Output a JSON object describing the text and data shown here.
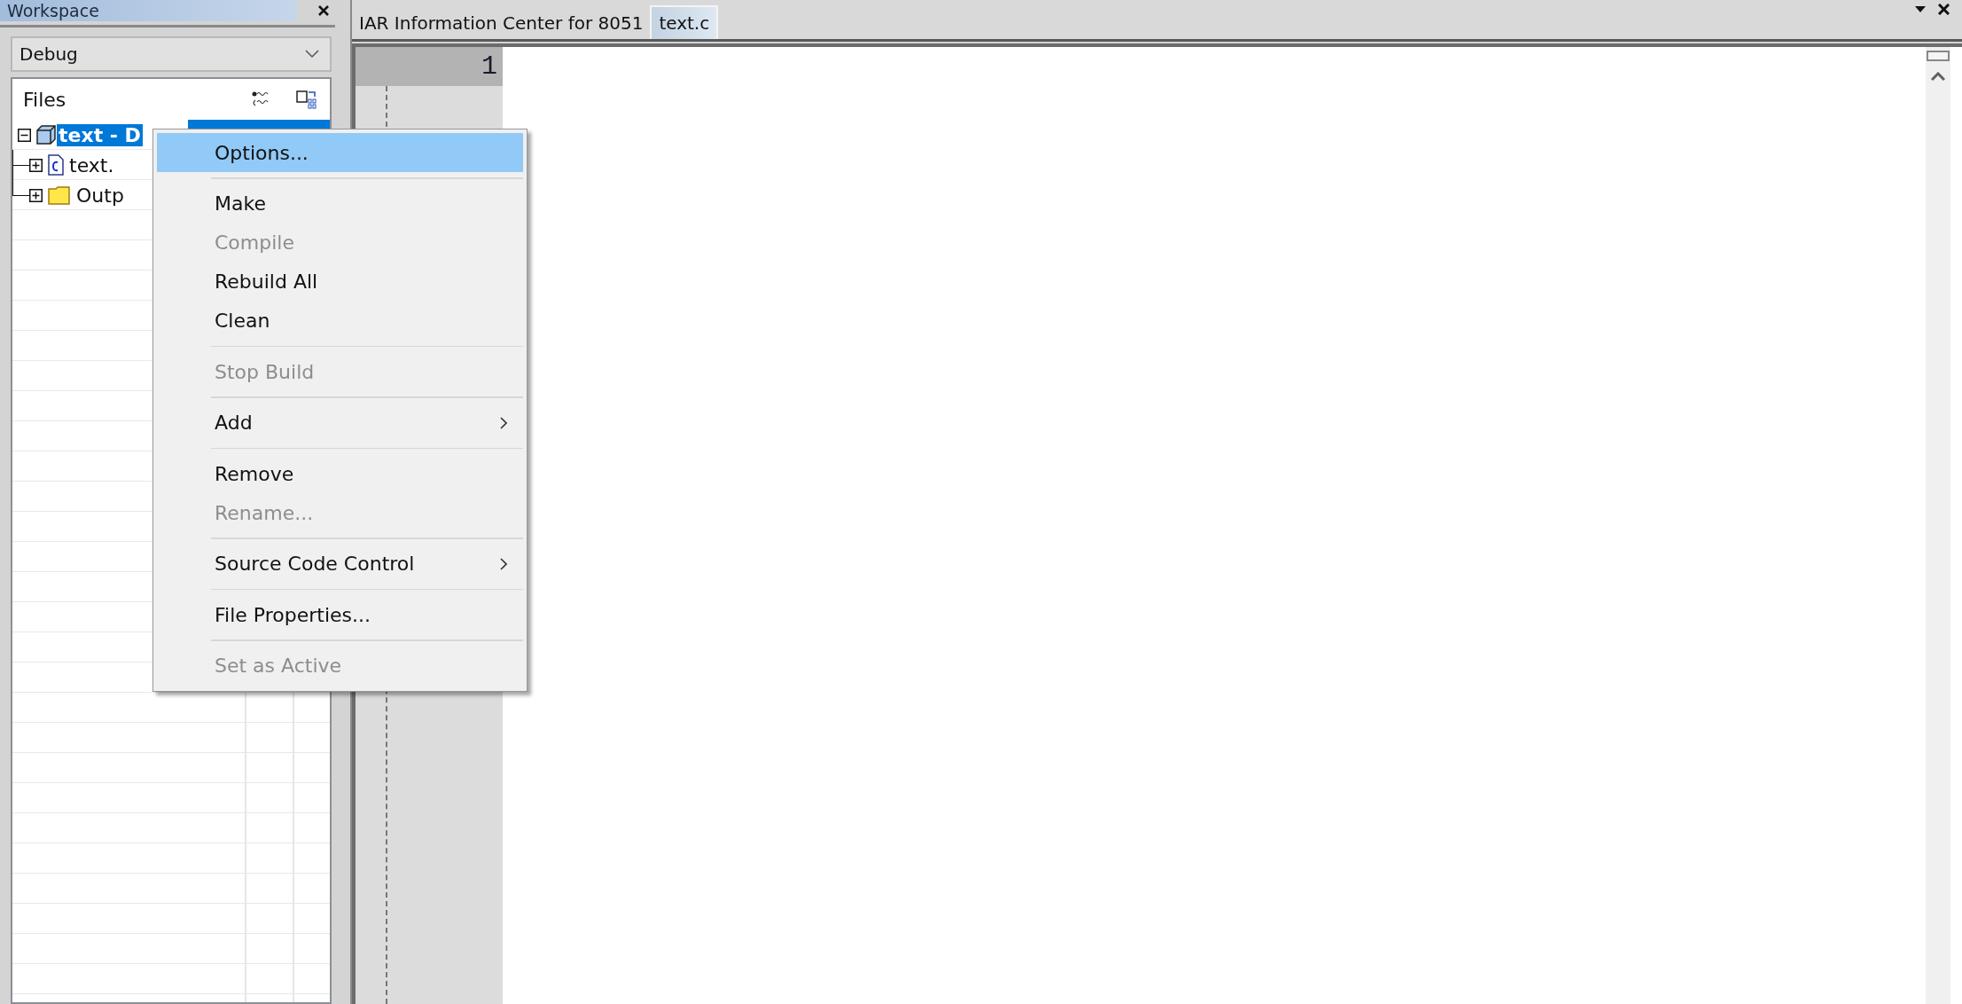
{
  "workspace": {
    "title": "Workspace",
    "configuration": "Debug",
    "files_header": "Files",
    "tree": [
      {
        "kind": "project",
        "label": "text - D",
        "selected": true,
        "expanded": true,
        "children": [
          {
            "kind": "c-file",
            "label": "text.",
            "selected": false,
            "expanded": false
          },
          {
            "kind": "folder",
            "label": "Outp",
            "selected": false,
            "expanded": false
          }
        ]
      }
    ]
  },
  "editor": {
    "tabs": [
      {
        "label": "IAR Information Center for 8051",
        "selected": false
      },
      {
        "label": "text.c",
        "selected": true
      }
    ],
    "line_numbers": [
      "1"
    ]
  },
  "context_menu": {
    "items": [
      {
        "kind": "item",
        "label": "Options...",
        "highlighted": true,
        "disabled": false,
        "submenu": false
      },
      {
        "kind": "separator"
      },
      {
        "kind": "item",
        "label": "Make",
        "highlighted": false,
        "disabled": false,
        "submenu": false
      },
      {
        "kind": "item",
        "label": "Compile",
        "highlighted": false,
        "disabled": true,
        "submenu": false
      },
      {
        "kind": "item",
        "label": "Rebuild All",
        "highlighted": false,
        "disabled": false,
        "submenu": false
      },
      {
        "kind": "item",
        "label": "Clean",
        "highlighted": false,
        "disabled": false,
        "submenu": false
      },
      {
        "kind": "separator"
      },
      {
        "kind": "item",
        "label": "Stop Build",
        "highlighted": false,
        "disabled": true,
        "submenu": false
      },
      {
        "kind": "separator"
      },
      {
        "kind": "item",
        "label": "Add",
        "highlighted": false,
        "disabled": false,
        "submenu": true
      },
      {
        "kind": "separator"
      },
      {
        "kind": "item",
        "label": "Remove",
        "highlighted": false,
        "disabled": false,
        "submenu": false
      },
      {
        "kind": "item",
        "label": "Rename...",
        "highlighted": false,
        "disabled": true,
        "submenu": false
      },
      {
        "kind": "separator"
      },
      {
        "kind": "item",
        "label": "Source Code Control",
        "highlighted": false,
        "disabled": false,
        "submenu": true
      },
      {
        "kind": "separator"
      },
      {
        "kind": "item",
        "label": "File Properties...",
        "highlighted": false,
        "disabled": false,
        "submenu": false
      },
      {
        "kind": "separator"
      },
      {
        "kind": "item",
        "label": "Set as Active",
        "highlighted": false,
        "disabled": true,
        "submenu": false
      }
    ]
  }
}
